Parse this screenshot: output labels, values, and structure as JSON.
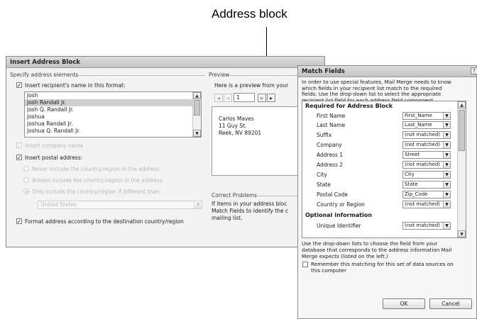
{
  "callout": {
    "label": "Address block"
  },
  "insert_address_block": {
    "title": "Insert Address Block",
    "specify_group": "Specify address elements",
    "insert_name_label": "Insert recipient's name in this format:",
    "name_formats": [
      "Josh",
      "Josh Randall Jr.",
      "Josh Q. Randall Jr.",
      "Joshua",
      "Joshua Randall Jr.",
      "Joshua Q. Randall Jr."
    ],
    "selected_index": 1,
    "insert_company_label": "Insert company name",
    "insert_postal_label": "Insert postal address:",
    "radio_never": "Never include the country/region in the address",
    "radio_always": "Always include the country/region in the address",
    "radio_only": "Only include the country/region if different than:",
    "country_value": "United States",
    "format_label": "Format address according to the destination country/region",
    "preview_group": "Preview",
    "preview_hint": "Here is a preview from your",
    "record_number": "1",
    "preview_address": [
      "Carlos Maves",
      "11 Guy St.",
      "Reek, NV 89201"
    ],
    "correct_group": "Correct Problems",
    "correct_text": [
      "If items in your address bloc",
      "Match Fields to identify the c",
      "mailing list."
    ]
  },
  "match_fields": {
    "title": "Match Fields",
    "intro": [
      "In order to use special features, Mail Merge needs to know",
      "which fields in your recipient list match to the required",
      "fields.  Use the drop-down list to select the appropriate",
      "recipient list field for each address field component."
    ],
    "required_header": "Required for Address Block",
    "rows": [
      {
        "label": "First Name",
        "value": "First_Name"
      },
      {
        "label": "Last Name",
        "value": "Last_Name"
      },
      {
        "label": "Suffix",
        "value": "(not matched)"
      },
      {
        "label": "Company",
        "value": "(not matched)"
      },
      {
        "label": "Address 1",
        "value": "Street"
      },
      {
        "label": "Address 2",
        "value": "(not matched)"
      },
      {
        "label": "City",
        "value": "City"
      },
      {
        "label": "State",
        "value": "State"
      },
      {
        "label": "Postal Code",
        "value": "Zip_Code"
      },
      {
        "label": "Country or Region",
        "value": "(not matched)"
      }
    ],
    "optional_header": "Optional information",
    "optional_row": {
      "label": "Unique Identifier",
      "value": "(not matched)"
    },
    "footer_text": [
      "Use the drop-down lists to choose the field from your",
      "database that corresponds to the address information Mail",
      "Merge expects (listed on the left.)"
    ],
    "remember_label": [
      "Remember this matching for this set of data sources on",
      "this computer"
    ],
    "ok_label": "OK",
    "cancel_label": "Cancel"
  }
}
